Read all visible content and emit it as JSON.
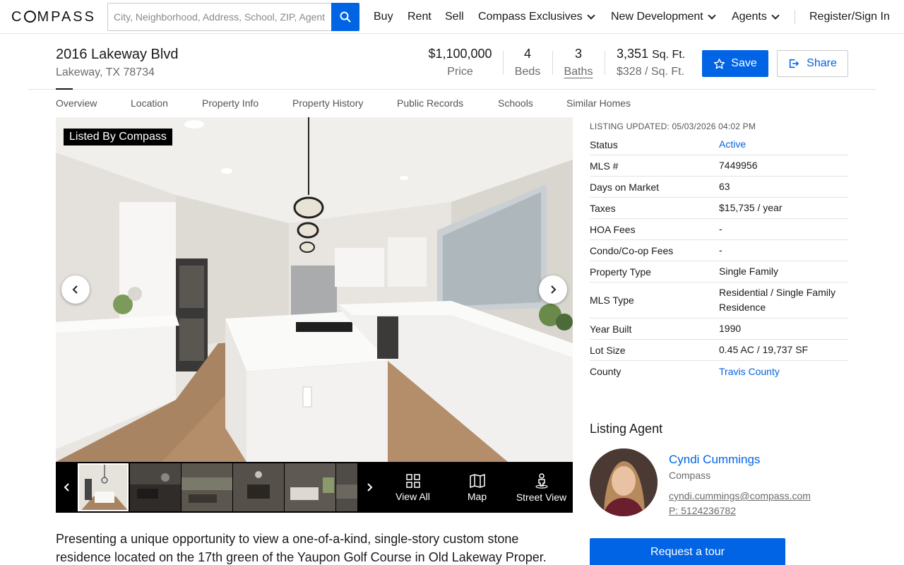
{
  "header": {
    "logo": "COMPASS",
    "search_placeholder": "City, Neighborhood, Address, School, ZIP, Agent",
    "nav": {
      "buy": "Buy",
      "rent": "Rent",
      "sell": "Sell",
      "exclusives": "Compass Exclusives",
      "new_dev": "New Development",
      "agents": "Agents",
      "register": "Register/Sign In"
    }
  },
  "listing": {
    "address": "2016 Lakeway Blvd",
    "city": "Lakeway, TX 78734",
    "price": "$1,100,000",
    "price_label": "Price",
    "beds": "4",
    "beds_label": "Beds",
    "baths": "3",
    "baths_label": "Baths",
    "sqft": "3,351",
    "sqft_unit": "Sq. Ft.",
    "price_per_sqft": "$328 / Sq. Ft.",
    "save_label": "Save",
    "share_label": "Share"
  },
  "tabs": [
    "Overview",
    "Location",
    "Property Info",
    "Property History",
    "Public Records",
    "Schools",
    "Similar Homes"
  ],
  "gallery": {
    "badge": "Listed By Compass",
    "view_all": "View All",
    "map": "Map",
    "street_view": "Street View"
  },
  "details": {
    "updated": "LISTING UPDATED: 05/03/2026 04:02 PM",
    "rows": [
      {
        "k": "Status",
        "v": "Active"
      },
      {
        "k": "MLS #",
        "v": "7449956"
      },
      {
        "k": "Days on Market",
        "v": "63"
      },
      {
        "k": "Taxes",
        "v": "$15,735 / year"
      },
      {
        "k": "HOA Fees",
        "v": "-"
      },
      {
        "k": "Condo/Co-op Fees",
        "v": "-"
      },
      {
        "k": "Property Type",
        "v": "Single Family"
      },
      {
        "k": "MLS Type",
        "v": "Residential / Single Family Residence"
      },
      {
        "k": "Year Built",
        "v": "1990"
      },
      {
        "k": "Lot Size",
        "v": "0.45 AC / 19,737 SF"
      },
      {
        "k": "County",
        "v": "Travis County"
      }
    ]
  },
  "agent": {
    "section_title": "Listing Agent",
    "name": "Cyndi Cummings",
    "company": "Compass",
    "email": "cyndi.cummings@compass.com",
    "phone": "P: 5124236782",
    "tour_label": "Request a tour"
  },
  "description": "Presenting a unique opportunity to view a one-of-a-kind, single-story custom stone residence located on the 17th green of the Yaupon Golf Course in Old Lakeway Proper.",
  "colors": {
    "accent": "#0064e5",
    "text": "#1a1a1a",
    "muted": "#6b6b6b"
  }
}
